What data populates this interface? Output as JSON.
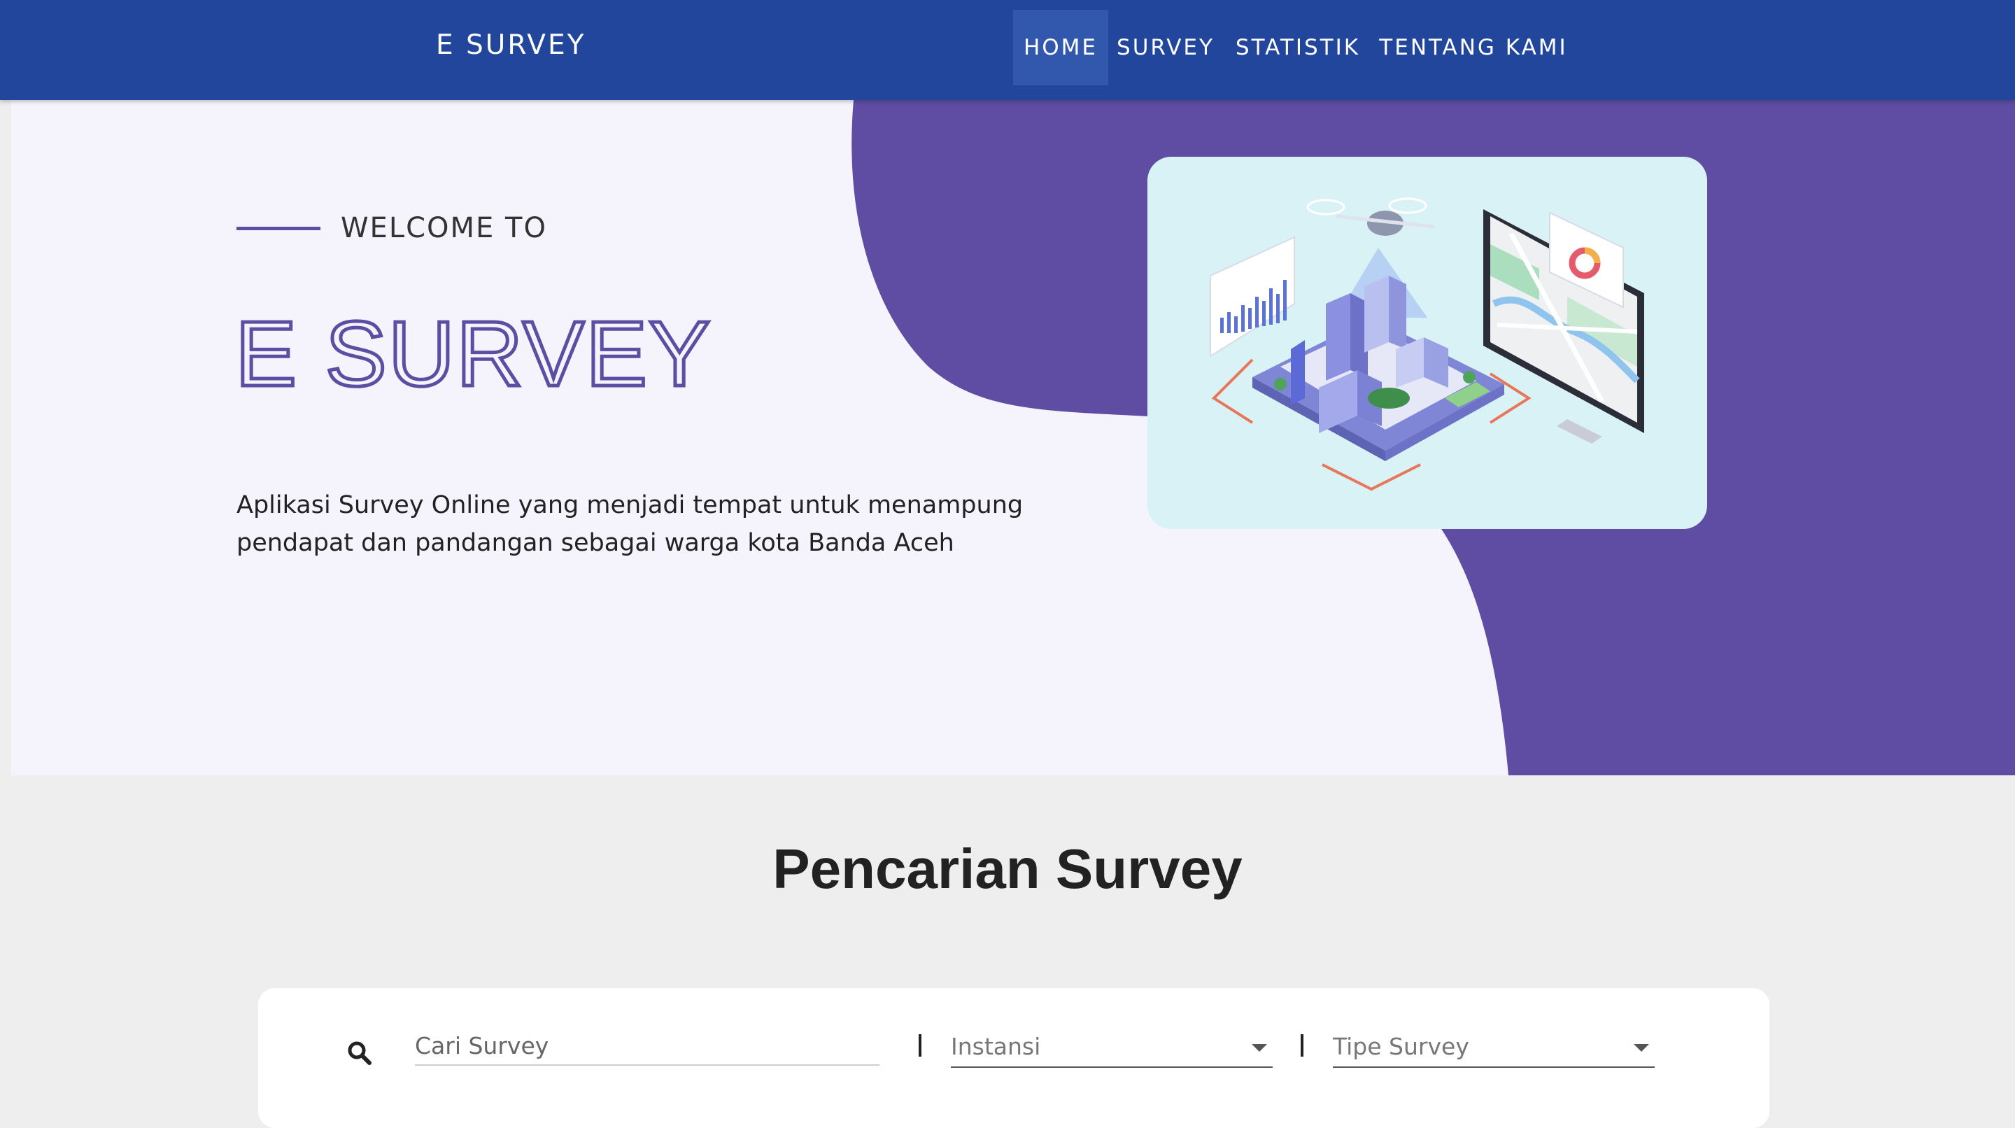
{
  "navbar": {
    "brand": "E SURVEY",
    "items": [
      {
        "label": "HOME",
        "active": true
      },
      {
        "label": "SURVEY"
      },
      {
        "label": "STATISTIK"
      },
      {
        "label": "TENTANG KAMI"
      }
    ]
  },
  "hero": {
    "welcome": "WELCOME TO",
    "title": "E SURVEY",
    "description_line1": "Aplikasi Survey Online yang menjadi tempat untuk menampung",
    "description_line2": "pendapat dan pandangan sebagai warga kota Banda Aceh"
  },
  "search": {
    "section_title": "Pencarian Survey",
    "input_placeholder": "Cari Survey",
    "separator": "|",
    "instansi_label": "Instansi",
    "tipe_label": "Tipe Survey"
  },
  "colors": {
    "navbar": "#21469c",
    "accent_purple": "#5c4ea3",
    "hero_bg": "#f5f4fd",
    "illustration_bg": "#d9f2f6"
  }
}
